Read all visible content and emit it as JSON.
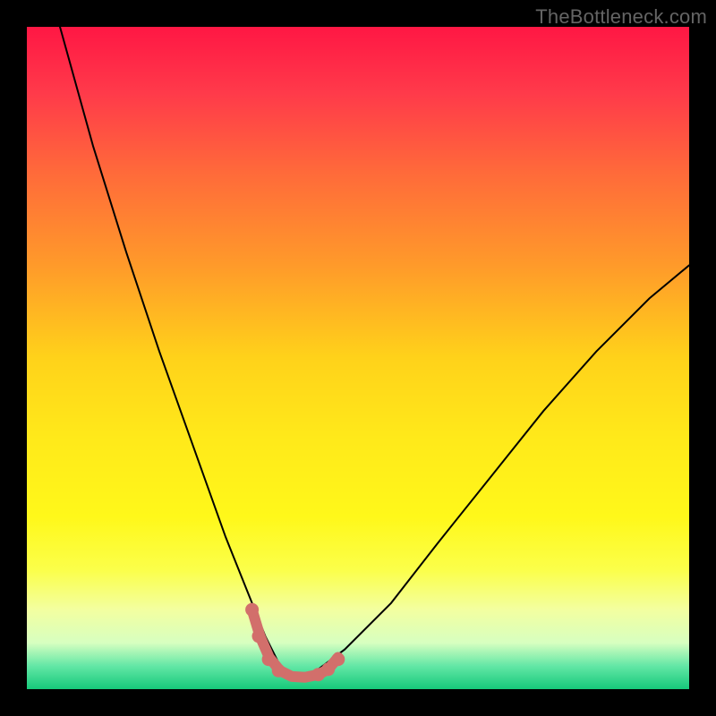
{
  "watermark": "TheBottleneck.com",
  "colors": {
    "frame_bg": "#000000",
    "curve": "#000000",
    "band": "#d26f6b",
    "dot": "#d26f6b",
    "watermark": "#646464"
  },
  "gradient_stops": [
    {
      "offset": 0.0,
      "color": "#ff1744"
    },
    {
      "offset": 0.1,
      "color": "#ff3a4a"
    },
    {
      "offset": 0.22,
      "color": "#ff6a3a"
    },
    {
      "offset": 0.36,
      "color": "#ff9a2a"
    },
    {
      "offset": 0.5,
      "color": "#ffd21a"
    },
    {
      "offset": 0.62,
      "color": "#ffe91a"
    },
    {
      "offset": 0.74,
      "color": "#fff81a"
    },
    {
      "offset": 0.82,
      "color": "#fbff4a"
    },
    {
      "offset": 0.88,
      "color": "#f3ffa0"
    },
    {
      "offset": 0.93,
      "color": "#d7ffc0"
    },
    {
      "offset": 0.965,
      "color": "#63e7a6"
    },
    {
      "offset": 1.0,
      "color": "#16c97a"
    }
  ],
  "chart_data": {
    "type": "line",
    "title": "",
    "xlabel": "",
    "ylabel": "",
    "xlim": [
      0,
      100
    ],
    "ylim": [
      0,
      100
    ],
    "note": "V-shaped bottleneck curve; y-axis inverted visually (0 at bottom = best). Values estimated from pixels.",
    "series": [
      {
        "name": "bottleneck-curve",
        "x": [
          5,
          10,
          15,
          20,
          25,
          30,
          34,
          36,
          38,
          40,
          42,
          44,
          48,
          55,
          62,
          70,
          78,
          86,
          94,
          100
        ],
        "y": [
          100,
          82,
          66,
          51,
          37,
          23,
          13,
          8,
          4,
          2,
          2,
          3,
          6,
          13,
          22,
          32,
          42,
          51,
          59,
          64
        ]
      }
    ],
    "minimum_band": {
      "x_start": 34,
      "x_end": 47,
      "y": 2
    },
    "marker_dots": [
      {
        "x": 34.0,
        "y": 12
      },
      {
        "x": 35.0,
        "y": 8
      },
      {
        "x": 36.5,
        "y": 4.5
      },
      {
        "x": 38.0,
        "y": 2.8
      },
      {
        "x": 44.0,
        "y": 2.2
      },
      {
        "x": 45.5,
        "y": 3.0
      },
      {
        "x": 47.0,
        "y": 4.5
      }
    ]
  }
}
